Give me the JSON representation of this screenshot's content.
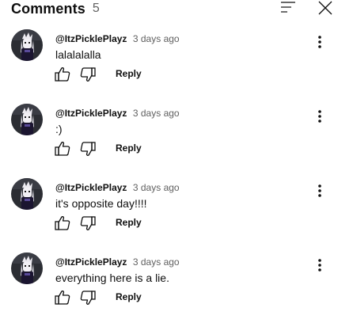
{
  "header": {
    "title": "Comments",
    "count": "5"
  },
  "icons": {
    "sort": "sort-icon",
    "close": "close-icon",
    "more": "more-vertical-icon",
    "like": "thumbs-up-icon",
    "dislike": "thumbs-down-icon"
  },
  "comments": [
    {
      "author": "@ItzPicklePlayz",
      "time": "3 days ago",
      "text": "lalalalalla",
      "reply_label": "Reply"
    },
    {
      "author": "@ItzPicklePlayz",
      "time": "3 days ago",
      "text": ":)",
      "reply_label": "Reply"
    },
    {
      "author": "@ItzPicklePlayz",
      "time": "3 days ago",
      "text": "it's opposite day!!!!",
      "reply_label": "Reply"
    },
    {
      "author": "@ItzPicklePlayz",
      "time": "3 days ago",
      "text": "everything here is a lie.",
      "reply_label": "Reply"
    }
  ]
}
